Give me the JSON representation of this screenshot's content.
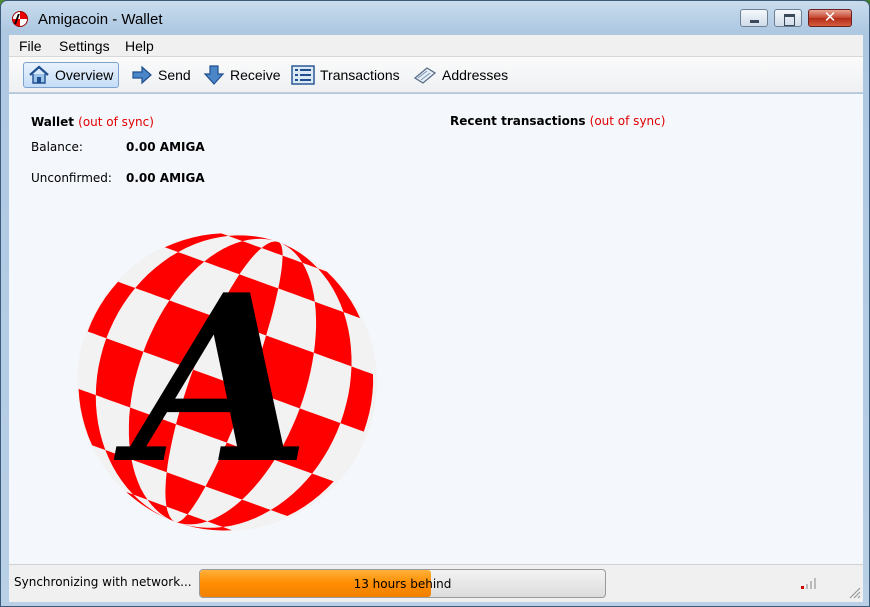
{
  "window": {
    "title": "Amigacoin - Wallet"
  },
  "menu": {
    "items": [
      {
        "label": "File"
      },
      {
        "label": "Settings"
      },
      {
        "label": "Help"
      }
    ]
  },
  "toolbar": {
    "items": [
      {
        "label": "Overview",
        "icon": "home-icon",
        "active": true
      },
      {
        "label": "Send",
        "icon": "arrow-right-icon"
      },
      {
        "label": "Receive",
        "icon": "arrow-down-icon"
      },
      {
        "label": "Transactions",
        "icon": "list-icon"
      },
      {
        "label": "Addresses",
        "icon": "address-book-icon"
      }
    ]
  },
  "overview": {
    "wallet_heading": "Wallet",
    "wallet_sync_status": "(out of sync)",
    "balance_label": "Balance:",
    "balance_value": "0.00 AMIGA",
    "unconfirmed_label": "Unconfirmed:",
    "unconfirmed_value": "0.00 AMIGA",
    "recent_heading": "Recent transactions",
    "recent_sync_status": "(out of sync)",
    "logo_letter": "A"
  },
  "status": {
    "sync_text": "Synchronizing with network...",
    "progress_text": "13 hours behind",
    "progress_fraction": 0.57
  },
  "colors": {
    "out_of_sync": "#e00000",
    "progress_fill": "#ff8c00",
    "logo_red": "#ff0000"
  }
}
